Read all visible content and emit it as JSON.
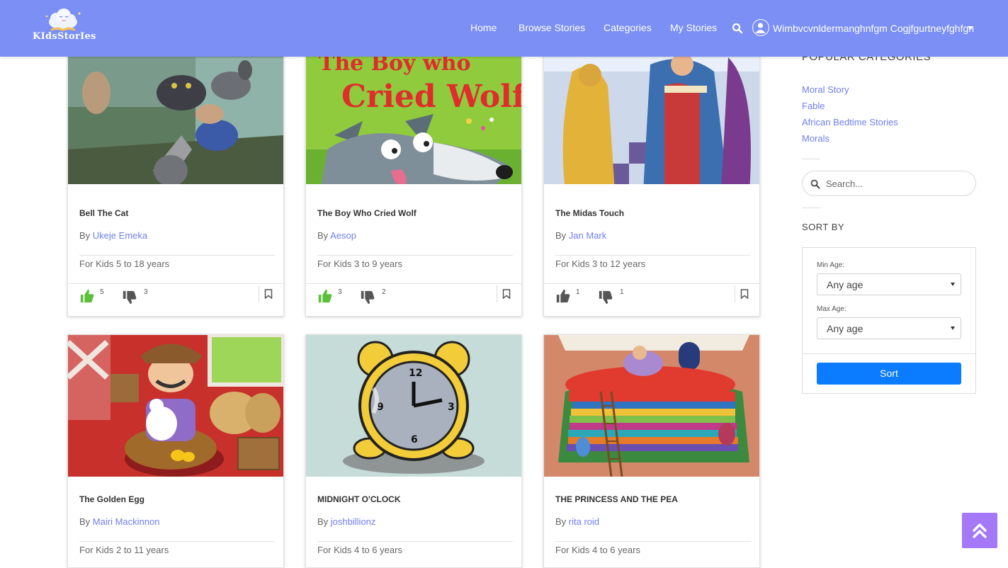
{
  "brand": {
    "name": "KIdsStorIes"
  },
  "nav": {
    "links": [
      "Home",
      "Browse Stories",
      "Categories",
      "My Stories"
    ],
    "user_name": "Wimbvcvnldermanghnfgm Cogjfgurtneyfghfgn"
  },
  "stories": [
    {
      "title": "Bell The Cat",
      "by_label": "By",
      "author": "Ukeje Emeka",
      "age": "For Kids 5 to 18 years",
      "likes": "5",
      "dislikes": "3",
      "liked": true
    },
    {
      "title": "The Boy Who Cried Wolf",
      "by_label": "By",
      "author": "Aesop",
      "age": "For Kids 3 to 9 years",
      "likes": "3",
      "dislikes": "2",
      "liked": true,
      "cover_text": [
        "The Boy who",
        "Cried Wolf"
      ]
    },
    {
      "title": "The Midas Touch",
      "by_label": "By",
      "author": "Jan Mark",
      "age": "For Kids 3 to 12 years",
      "likes": "1",
      "dislikes": "1",
      "liked": false
    },
    {
      "title": "The Golden Egg",
      "by_label": "By",
      "author": "Mairi Mackinnon",
      "age": "For Kids 2 to 11 years"
    },
    {
      "title": "MIDNIGHT O'CLOCK",
      "by_label": "By",
      "author": "joshbillionz",
      "age": "For Kids 4 to 6 years"
    },
    {
      "title": "THE PRINCESS AND THE PEA",
      "by_label": "By",
      "author": "rita roid",
      "age": "For Kids 4 to 6 years"
    }
  ],
  "sidebar": {
    "popular_heading": "POPULAR CATEGORIES",
    "categories": [
      "Moral Story",
      "Fable",
      "African Bedtime Stories",
      "Morals"
    ],
    "search_placeholder": "Search...",
    "sort_heading": "SORT BY",
    "min_age_label": "Min Age:",
    "min_age_value": "Any age",
    "max_age_label": "Max Age:",
    "max_age_value": "Any age",
    "sort_button": "Sort"
  },
  "colors": {
    "nav_bg": "#7b8ff4",
    "link": "#6f7ff0",
    "sort_button": "#0b7bff",
    "scroll_top": "#a478f7",
    "like_active": "#5bbf3a"
  }
}
